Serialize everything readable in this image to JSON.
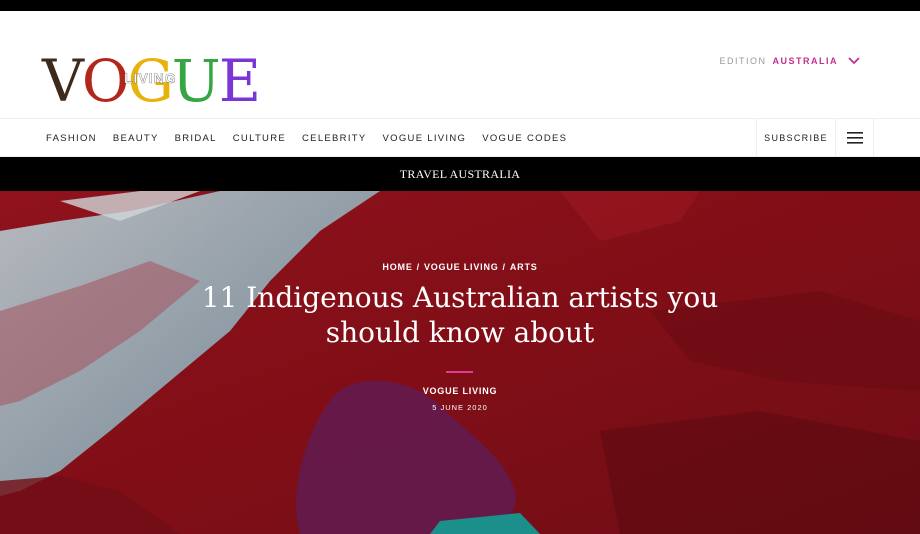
{
  "header": {
    "logo_text": "VOGUE",
    "logo_sub": "LIVING",
    "edition_label": "EDITION",
    "edition_value": "AUSTRALIA"
  },
  "nav": {
    "items": [
      "FASHION",
      "BEAUTY",
      "BRIDAL",
      "CULTURE",
      "CELEBRITY",
      "VOGUE LIVING",
      "VOGUE CODES"
    ],
    "subscribe": "SUBSCRIBE"
  },
  "section": "TRAVEL AUSTRALIA",
  "article": {
    "breadcrumb": [
      "HOME",
      "VOGUE LIVING",
      "ARTS"
    ],
    "title": "11 Indigenous Australian artists you should know about",
    "author": "VOGUE LIVING",
    "date": "5 JUNE 2020"
  },
  "colors": {
    "accent": "#c2318b",
    "rule": "#e63a8e",
    "logo": [
      "#3d2a1a",
      "#6b1c12",
      "#e8b20a",
      "#35a642",
      "#2a5fd8",
      "#8b2fd0"
    ]
  }
}
